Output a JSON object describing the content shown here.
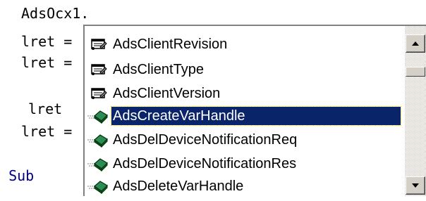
{
  "editor": {
    "lines": [
      "AdsOcx1.",
      "lret =",
      "lret =",
      "lret",
      "lret =",
      "d Sub"
    ]
  },
  "autocomplete": {
    "items": [
      {
        "label": "AdsClientRevision",
        "icon": "property-icon"
      },
      {
        "label": "AdsClientType",
        "icon": "property-icon"
      },
      {
        "label": "AdsClientVersion",
        "icon": "property-icon"
      },
      {
        "label": "AdsCreateVarHandle",
        "icon": "method-icon",
        "selected": true
      },
      {
        "label": "AdsDelDeviceNotificationReq",
        "icon": "method-icon"
      },
      {
        "label": "AdsDelDeviceNotificationRes",
        "icon": "method-icon"
      },
      {
        "label": "AdsDeleteVarHandle",
        "icon": "method-icon"
      }
    ],
    "scroll_position": 0.1
  },
  "colors": {
    "selection": "#0a246a",
    "keyword": "#00007f",
    "scrollbar_face": "#d4d0c8"
  }
}
